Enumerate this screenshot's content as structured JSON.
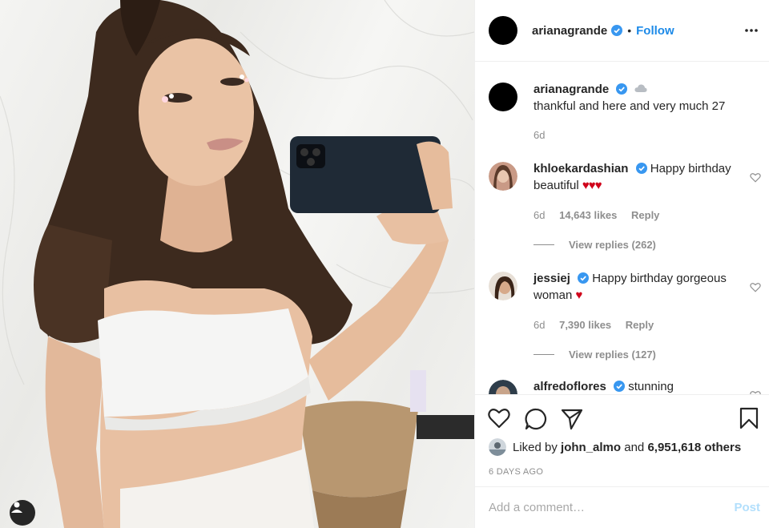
{
  "post": {
    "username": "arianagrande",
    "separator": "•",
    "follow_label": "Follow",
    "more_icon": "more-horizontal-icon"
  },
  "caption": {
    "username": "arianagrande",
    "emoji": "cloud",
    "text": "thankful and here and very much 27",
    "time": "6d"
  },
  "comments": [
    {
      "username": "khloekardashian",
      "verified": true,
      "text": "Happy birthday beautiful",
      "hearts": "♥♥♥",
      "time": "6d",
      "likes": "14,643 likes",
      "reply_label": "Reply",
      "replies": "View replies (262)"
    },
    {
      "username": "jessiej",
      "verified": true,
      "text": "Happy birthday gorgeous woman",
      "hearts": "♥",
      "time": "6d",
      "likes": "7,390 likes",
      "reply_label": "Reply",
      "replies": "View replies (127)"
    },
    {
      "username": "alfredoflores",
      "verified": true,
      "text": "stunning"
    }
  ],
  "likes": {
    "prefix": "Liked by",
    "user": "john_almo",
    "joiner": "and",
    "others": "6,951,618 others"
  },
  "timestamp": "6 DAYS AGO",
  "add_comment": {
    "placeholder": "Add a comment…",
    "post_label": "Post"
  },
  "colors": {
    "verified": "#3897f0",
    "link": "#1d8ae8",
    "heart_red": "#d0021b",
    "post_disabled": "#b2dffc"
  }
}
